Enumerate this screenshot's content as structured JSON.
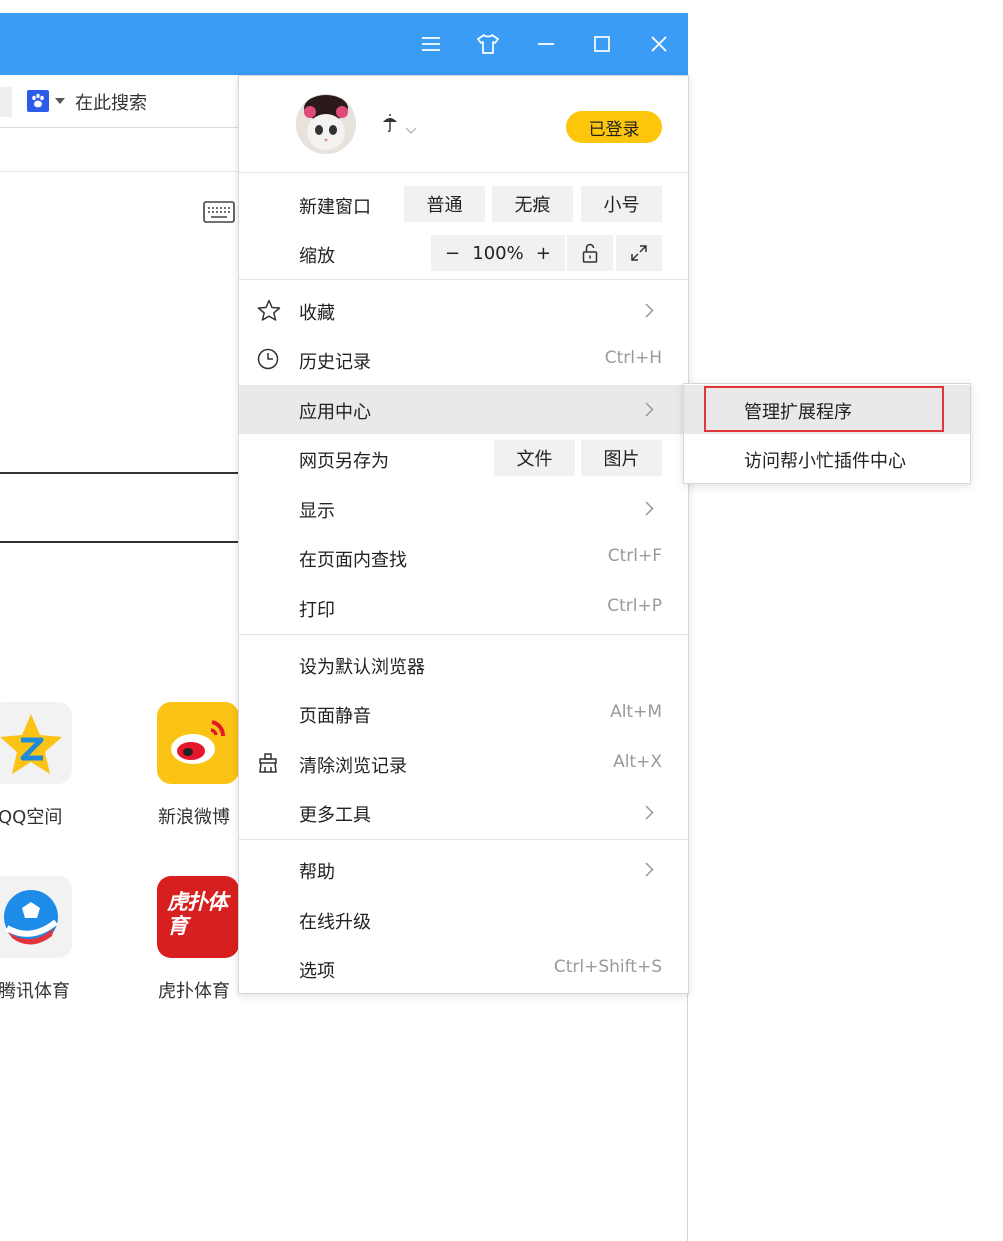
{
  "background": {
    "search_placeholder": "在此搜索",
    "apps": [
      {
        "label": "QQ空间",
        "icon": "qzone-icon"
      },
      {
        "label": "新浪微博",
        "icon": "weibo-icon"
      },
      {
        "label": "腾讯体育",
        "icon": "tencent-sports-icon"
      },
      {
        "label": "虎扑体育",
        "icon": "hupu-icon",
        "logo_text": "虎扑体育"
      }
    ]
  },
  "menu": {
    "user": {
      "status": "已登录"
    },
    "new_window": {
      "label": "新建窗口",
      "options": [
        "普通",
        "无痕",
        "小号"
      ]
    },
    "zoom": {
      "label": "缩放",
      "minus": "−",
      "value": "100%",
      "plus": "+"
    },
    "items_group1": [
      {
        "label": "收藏",
        "icon": "star-icon",
        "shortcut": "",
        "submenu": true
      },
      {
        "label": "历史记录",
        "icon": "clock-icon",
        "shortcut": "Ctrl+H",
        "submenu": false
      },
      {
        "label": "应用中心",
        "icon": "",
        "shortcut": "",
        "submenu": true
      },
      {
        "label": "网页另存为",
        "icon": "",
        "shortcut": "",
        "submenu": false
      },
      {
        "label": "显示",
        "icon": "",
        "shortcut": "",
        "submenu": true
      },
      {
        "label": "在页面内查找",
        "icon": "",
        "shortcut": "Ctrl+F",
        "submenu": false
      },
      {
        "label": "打印",
        "icon": "",
        "shortcut": "Ctrl+P",
        "submenu": false
      }
    ],
    "save_options": [
      "文件",
      "图片"
    ],
    "items_group2": [
      {
        "label": "设为默认浏览器",
        "icon": "",
        "shortcut": "",
        "submenu": false
      },
      {
        "label": "页面静音",
        "icon": "",
        "shortcut": "Alt+M",
        "submenu": false
      },
      {
        "label": "清除浏览记录",
        "icon": "broom-icon",
        "shortcut": "Alt+X",
        "submenu": false
      },
      {
        "label": "更多工具",
        "icon": "",
        "shortcut": "",
        "submenu": true
      }
    ],
    "items_group3": [
      {
        "label": "帮助",
        "icon": "",
        "shortcut": "",
        "submenu": true
      },
      {
        "label": "在线升级",
        "icon": "",
        "shortcut": "",
        "submenu": false
      },
      {
        "label": "选项",
        "icon": "",
        "shortcut": "Ctrl+Shift+S",
        "submenu": false
      }
    ]
  },
  "submenu": {
    "items": [
      "管理扩展程序",
      "访问帮小忙插件中心"
    ],
    "highlighted_index": 0
  },
  "colors": {
    "titlebar": "#3b9cf6",
    "login_badge": "#fdc60b",
    "highlight_border": "#e2343b",
    "hover": "#e9e9e9"
  }
}
